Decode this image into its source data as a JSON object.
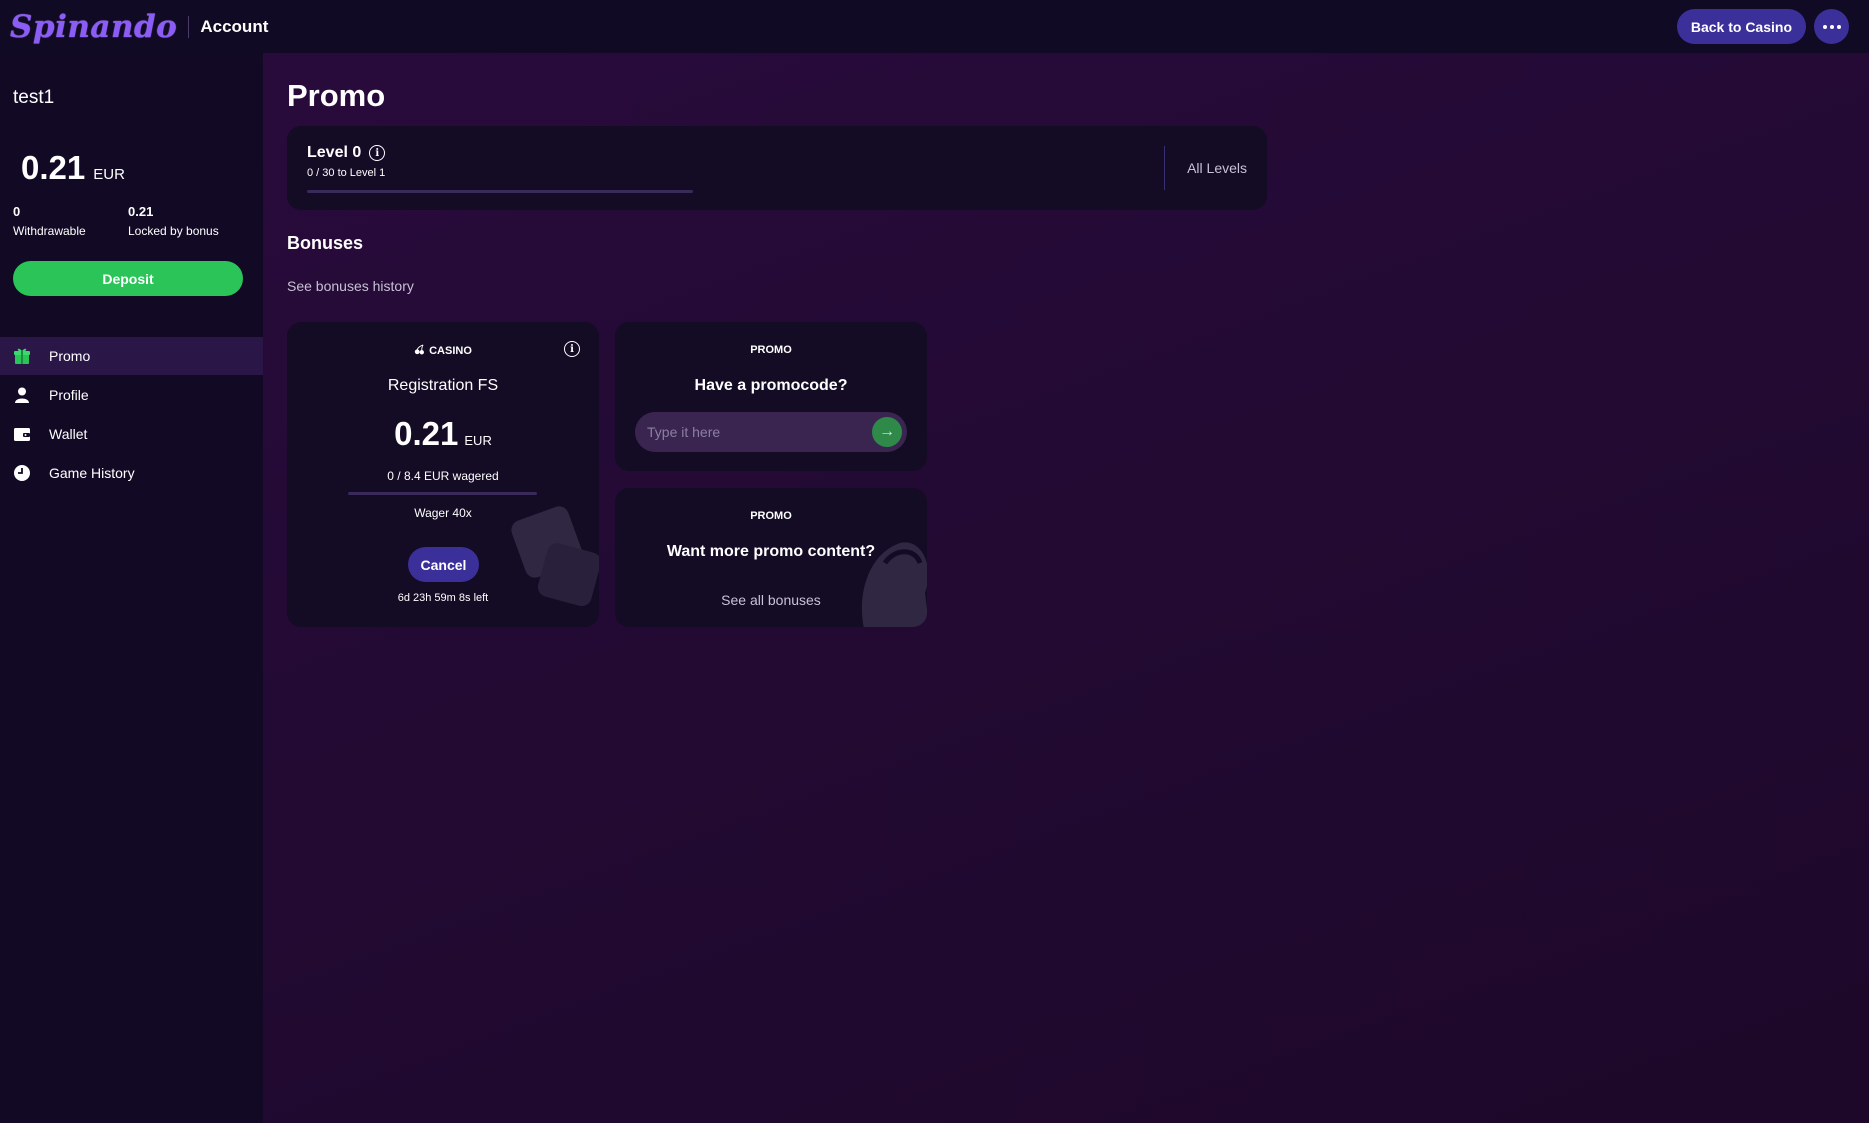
{
  "header": {
    "logo": "Spinando",
    "section_title": "Account",
    "back_button": "Back to Casino",
    "more_icon": "ellipsis-icon"
  },
  "sidebar": {
    "username": "test1",
    "balance": {
      "amount": "0.21",
      "currency": "EUR"
    },
    "withdrawable": {
      "value": "0",
      "label": "Withdrawable"
    },
    "locked": {
      "value": "0.21",
      "label": "Locked by bonus"
    },
    "deposit_button": "Deposit",
    "nav": [
      {
        "label": "Promo",
        "icon": "gift-icon",
        "active": true
      },
      {
        "label": "Profile",
        "icon": "user-icon",
        "active": false
      },
      {
        "label": "Wallet",
        "icon": "wallet-icon",
        "active": false
      },
      {
        "label": "Game History",
        "icon": "clock-icon",
        "active": false
      }
    ],
    "accent_color": "#2bc459"
  },
  "main": {
    "title": "Promo",
    "level": {
      "title": "Level 0",
      "progress_text": "0 / 30 to Level 1",
      "progress_fraction": 0,
      "all_levels": "All Levels"
    },
    "bonuses": {
      "title": "Bonuses",
      "history_link": "See bonuses history",
      "casino_card": {
        "tag": "CASINO",
        "name": "Registration FS",
        "amount": "0.21",
        "currency": "EUR",
        "wagered_text": "0 / 8.4 EUR wagered",
        "wager_fraction": 0,
        "wager_label": "Wager 40x",
        "cancel_button": "Cancel",
        "time_left": "6d 23h 59m 8s left"
      },
      "promocode_card": {
        "tag": "PROMO",
        "heading": "Have a promocode?",
        "placeholder": "Type it here",
        "submit_icon": "arrow-right-icon"
      },
      "promo_content_card": {
        "tag": "PROMO",
        "heading": "Want more promo content?",
        "link": "See all bonuses"
      }
    }
  },
  "colors": {
    "primary_button": "#3b2f9a",
    "deposit_green": "#2bc459",
    "background": "#230a34",
    "sidebar": "#120a25",
    "card": "#140b25"
  }
}
